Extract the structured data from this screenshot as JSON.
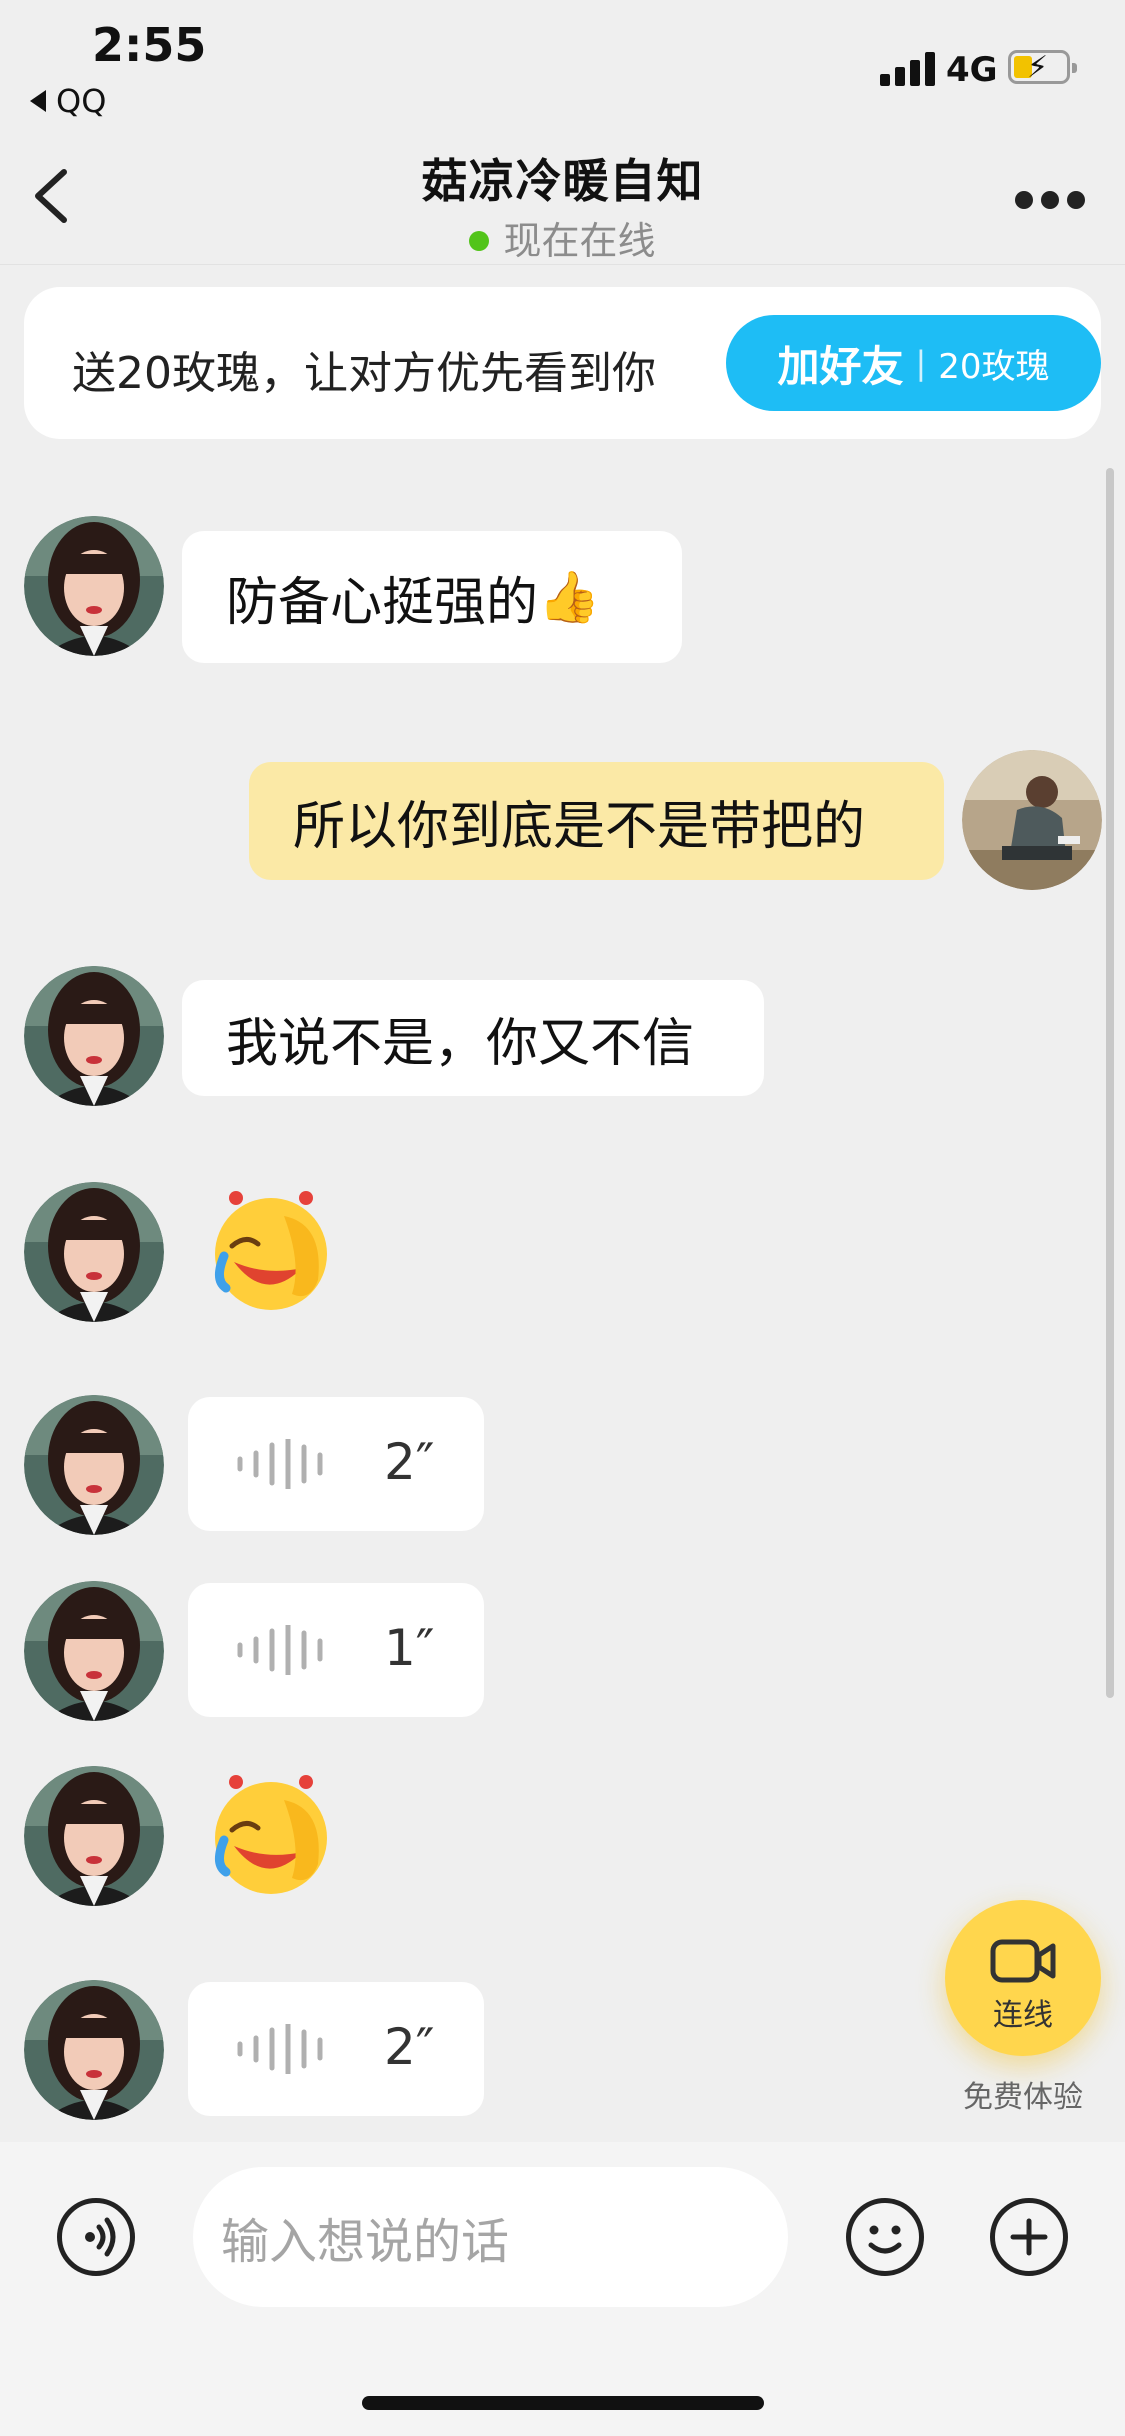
{
  "status_bar": {
    "time": "2:55",
    "back_app": "QQ",
    "network": "4G",
    "icons": [
      "signal-icon",
      "battery-charging-icon"
    ]
  },
  "nav": {
    "title": "菇凉冷暖自知",
    "status": "现在在线",
    "icons": [
      "back-chevron-icon",
      "more-icon"
    ]
  },
  "promo": {
    "text": "送20玫瑰，让对方优先看到你",
    "button_main": "加好友",
    "button_separator": "|",
    "button_sub": "20玫瑰"
  },
  "messages": [
    {
      "sender": "other",
      "type": "text",
      "text": "防备心挺强的",
      "emoji": "👍"
    },
    {
      "sender": "me",
      "type": "text",
      "text": "所以你到底是不是带把的"
    },
    {
      "sender": "other",
      "type": "text",
      "text": "我说不是，你又不信"
    },
    {
      "sender": "other",
      "type": "sticker",
      "sticker": "laughing-tears-sticker"
    },
    {
      "sender": "other",
      "type": "voice",
      "duration": "2″"
    },
    {
      "sender": "other",
      "type": "voice",
      "duration": "1″"
    },
    {
      "sender": "other",
      "type": "sticker",
      "sticker": "laughing-tears-sticker"
    },
    {
      "sender": "other",
      "type": "voice",
      "duration": "2″"
    }
  ],
  "call_fab": {
    "label": "连线",
    "sub_label": "免费体验"
  },
  "input_bar": {
    "placeholder": "输入想说的话",
    "icons": [
      "voice-input-icon",
      "emoji-icon",
      "plus-icon"
    ]
  },
  "colors": {
    "accent": "#1ebdf5",
    "my_bubble": "#fbe9a6",
    "online_dot": "#52c41a",
    "call_button": "#ffd64d",
    "background": "#efefef"
  }
}
